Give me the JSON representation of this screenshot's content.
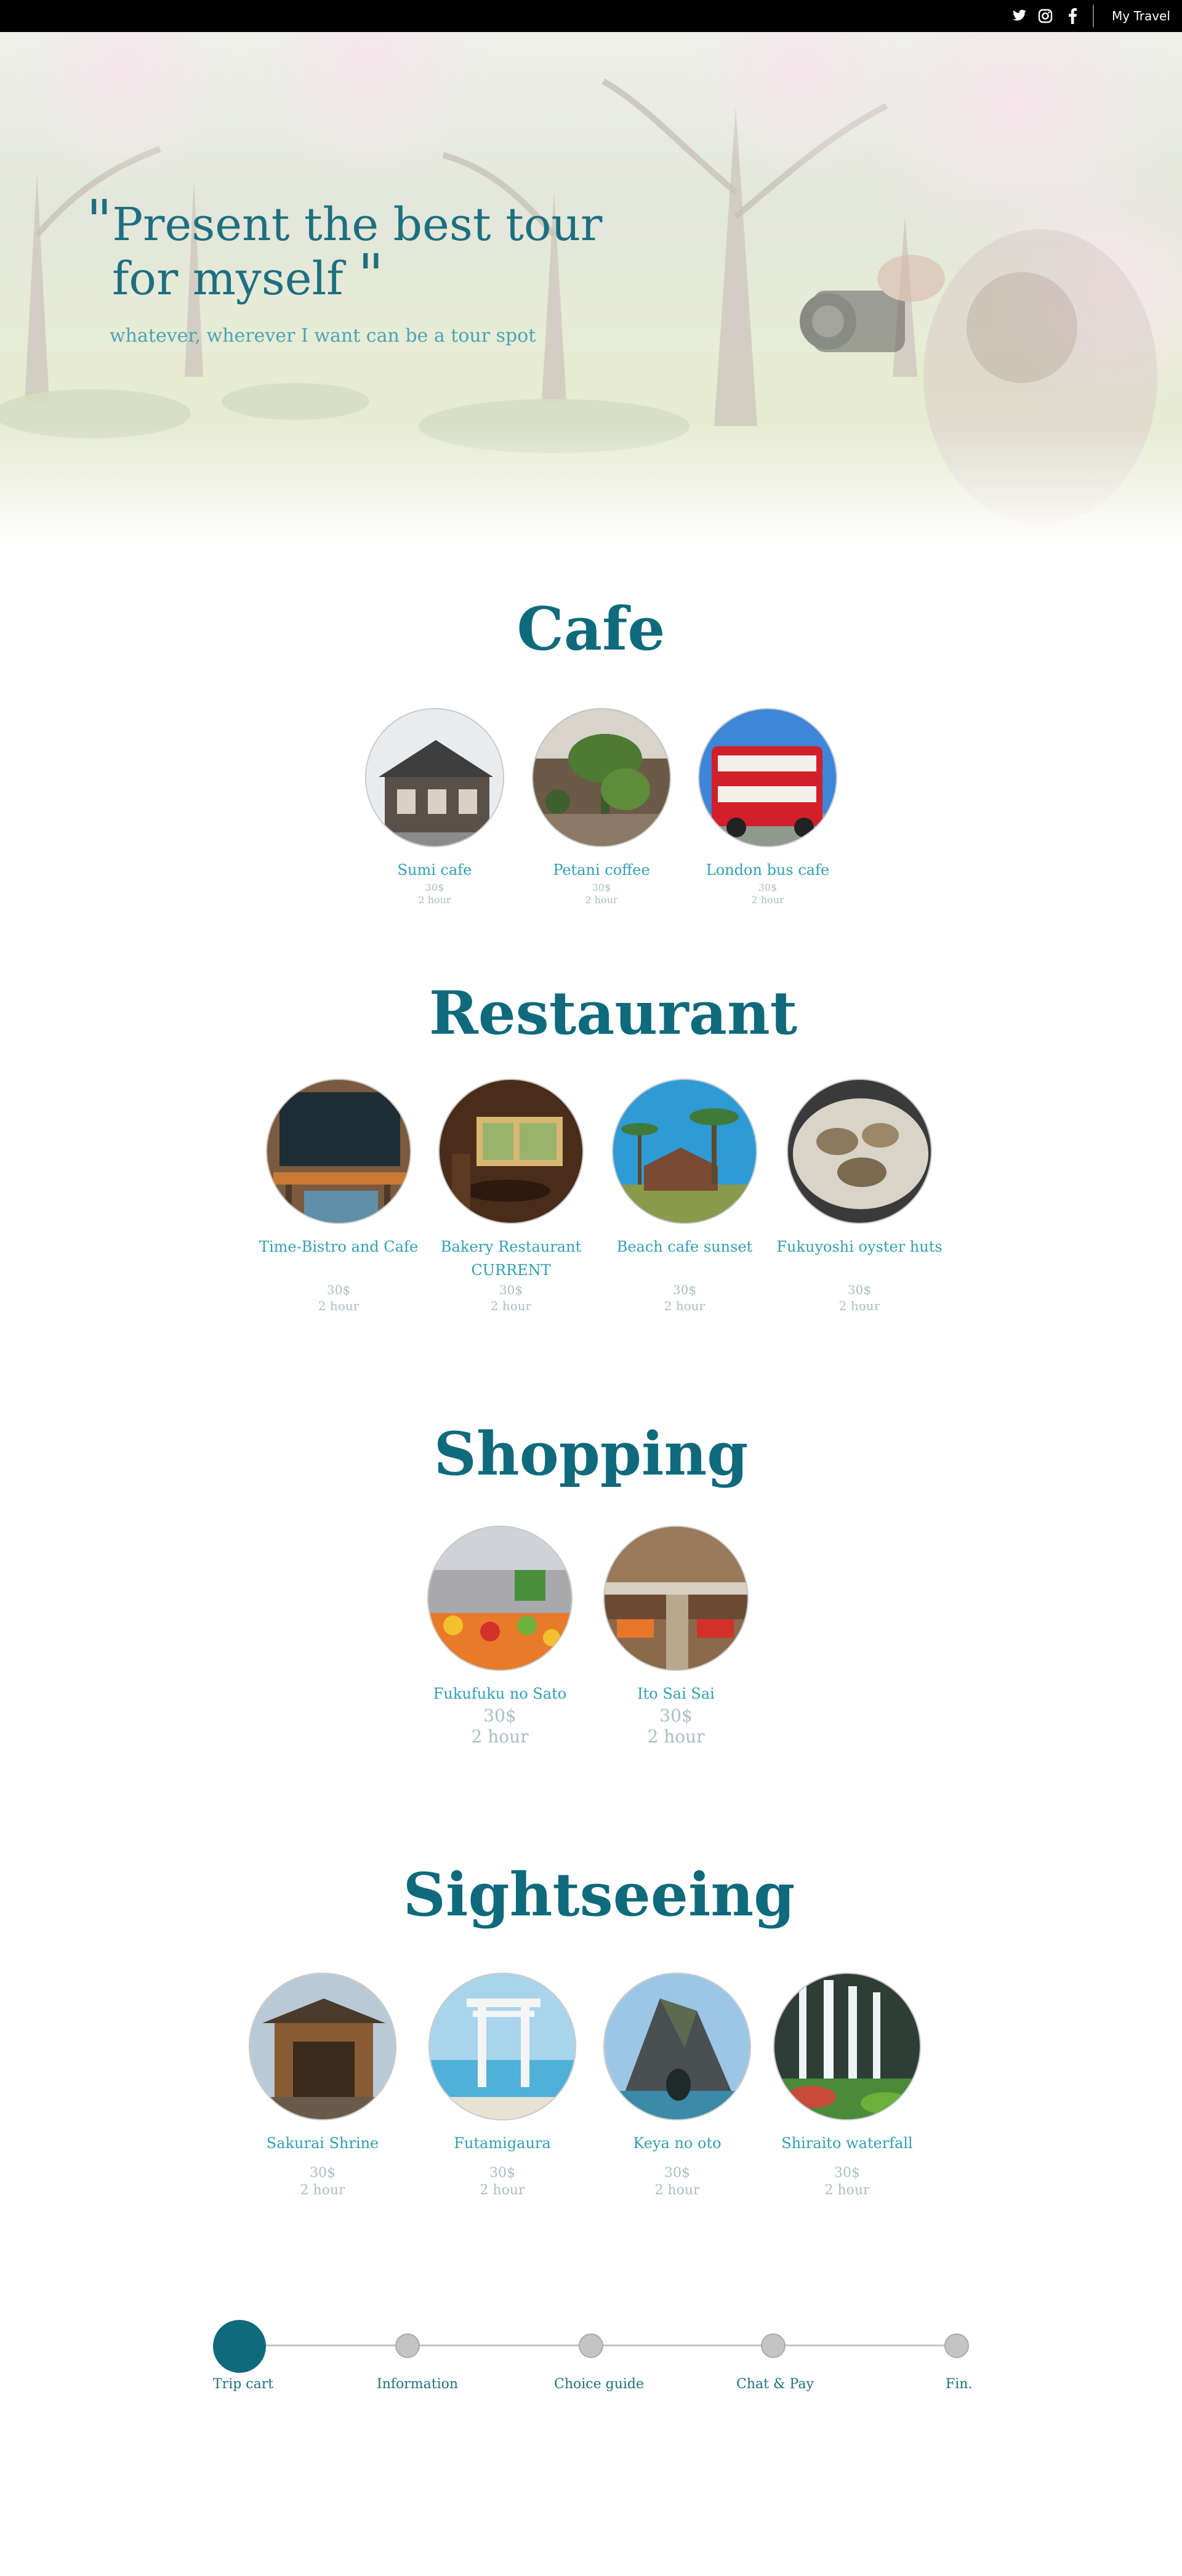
{
  "topbar": {
    "icons": [
      "twitter-icon",
      "instagram-icon",
      "facebook-icon"
    ],
    "link_label": "My Travel"
  },
  "hero": {
    "quote_line1": "Present the best tour",
    "quote_line2": "for myself",
    "open_quote": "\"",
    "close_quote": "\"",
    "subtitle": "whatever, wherever I want can be a tour spot"
  },
  "sections": {
    "cafe": {
      "title": "Cafe",
      "items": [
        {
          "name": "Sumi cafe",
          "price": "30$",
          "duration": "2 hour"
        },
        {
          "name": "Petani coffee",
          "price": "30$",
          "duration": "2 hour"
        },
        {
          "name": "London bus cafe",
          "price": "30$",
          "duration": "2 hour"
        }
      ]
    },
    "restaurant": {
      "title": "Restaurant",
      "items": [
        {
          "name": "Time-Bistro and Cafe",
          "sub": "",
          "price": "30$",
          "duration": "2 hour"
        },
        {
          "name": "Bakery Restaurant",
          "sub": "CURRENT",
          "price": "30$",
          "duration": "2 hour"
        },
        {
          "name": "Beach cafe sunset",
          "sub": "",
          "price": "30$",
          "duration": "2 hour"
        },
        {
          "name": "Fukuyoshi oyster huts",
          "sub": "",
          "price": "30$",
          "duration": "2 hour"
        }
      ]
    },
    "shopping": {
      "title": "Shopping",
      "items": [
        {
          "name": "Fukufuku no Sato",
          "price": "30$",
          "duration": "2 hour"
        },
        {
          "name": "Ito Sai Sai",
          "price": "30$",
          "duration": "2 hour"
        }
      ]
    },
    "sightseeing": {
      "title": "Sightseeing",
      "items": [
        {
          "name": "Sakurai Shrine",
          "price": "30$",
          "duration": "2 hour"
        },
        {
          "name": "Futamigaura",
          "price": "30$",
          "duration": "2 hour"
        },
        {
          "name": "Keya no oto",
          "price": "30$",
          "duration": "2 hour"
        },
        {
          "name": "Shiraito waterfall",
          "price": "30$",
          "duration": "2 hour"
        }
      ]
    }
  },
  "progress": {
    "steps": [
      "Trip cart",
      "Information",
      "Choice guide",
      "Chat & Pay",
      "Fin."
    ],
    "current_step": 1
  },
  "colors": {
    "accent": "#0f6a7b",
    "item_name": "#2f9fb3",
    "item_meta": "#a7bfc4",
    "inactive_step": "#c4c4c4"
  }
}
